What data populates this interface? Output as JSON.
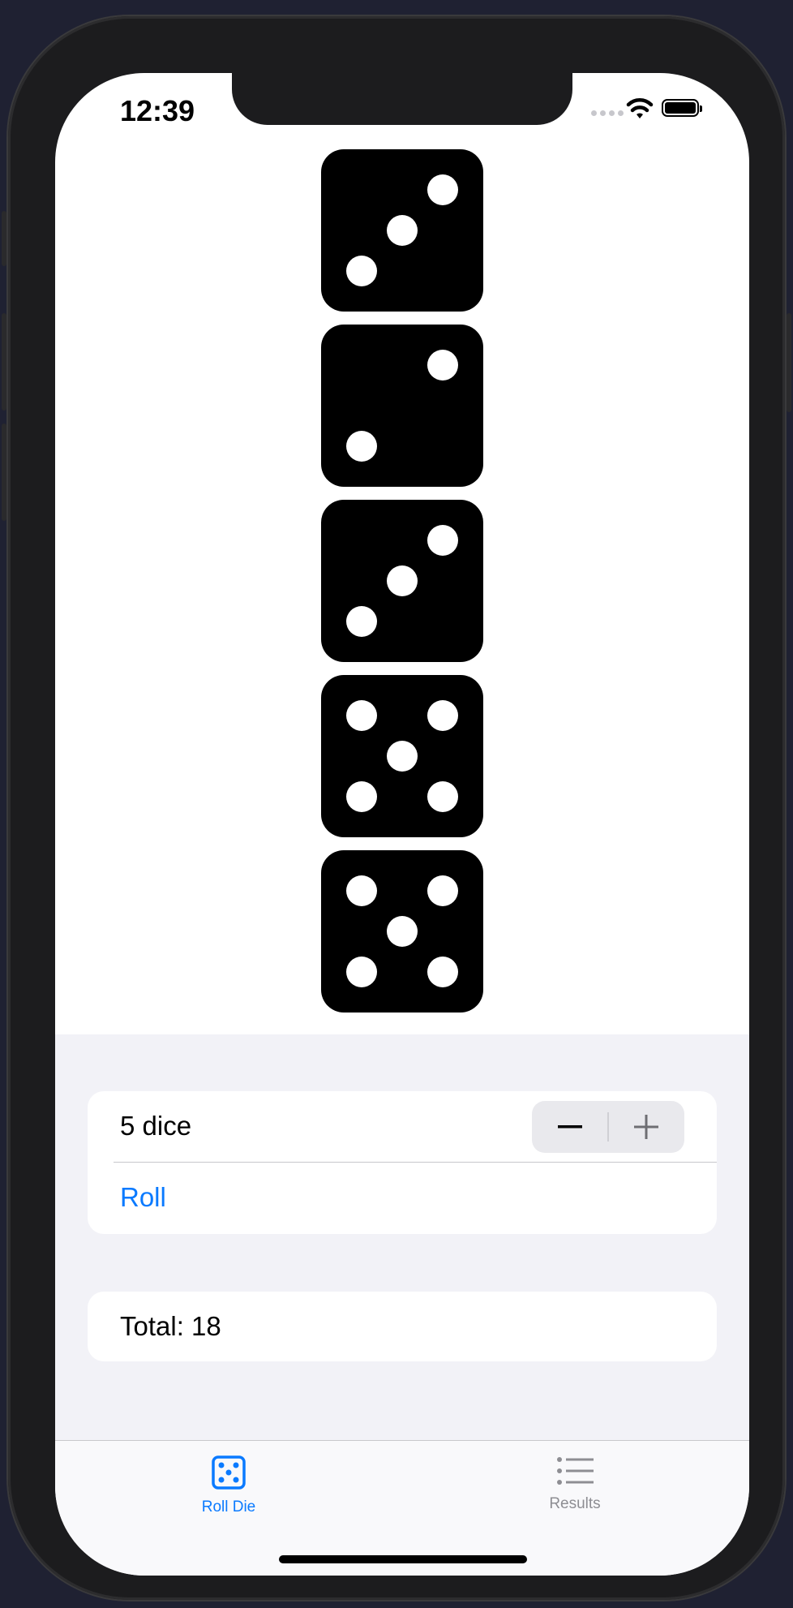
{
  "status_bar": {
    "time": "12:39"
  },
  "dice": [
    {
      "value": 3,
      "pips": [
        "tr",
        "c",
        "bl"
      ]
    },
    {
      "value": 2,
      "pips": [
        "tr",
        "bl"
      ]
    },
    {
      "value": 3,
      "pips": [
        "tr",
        "c",
        "bl"
      ]
    },
    {
      "value": 5,
      "pips": [
        "tl",
        "tr",
        "c",
        "bl",
        "br"
      ]
    },
    {
      "value": 5,
      "pips": [
        "tl",
        "tr",
        "c",
        "bl",
        "br"
      ]
    }
  ],
  "controls": {
    "dice_count_label": "5 dice",
    "roll_label": "Roll",
    "total_label": "Total: 18"
  },
  "tabs": [
    {
      "label": "Roll Die",
      "icon": "die-face-icon",
      "active": true
    },
    {
      "label": "Results",
      "icon": "list-icon",
      "active": false
    }
  ],
  "colors": {
    "accent": "#0a7aff",
    "inactive": "#8e8e93",
    "grouped_bg": "#f2f2f7"
  }
}
